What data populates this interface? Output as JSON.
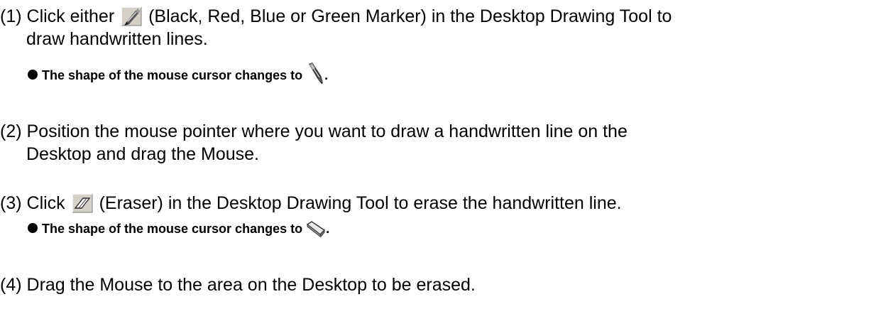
{
  "steps": [
    {
      "number": "(1)",
      "text_before_icon": "Click either",
      "icon": "marker-pen-icon",
      "text_after_icon_line1": "(Black, Red, Blue or Green Marker) in the Desktop Drawing Tool to",
      "text_line2": "draw handwritten lines.",
      "note": "The shape of the mouse cursor changes to",
      "note_icon": "marker-cursor-icon",
      "note_end": "."
    },
    {
      "number": "(2)",
      "text_line1": "Position the mouse pointer where you want to draw a handwritten line on the",
      "text_line2": "Desktop and drag the Mouse."
    },
    {
      "number": "(3)",
      "text_before_icon": "Click",
      "icon": "eraser-icon",
      "text_after_icon_line1": "(Eraser) in the Desktop Drawing Tool to erase the handwritten line.",
      "note": "The shape of the mouse cursor changes to",
      "note_icon": "eraser-cursor-icon",
      "note_end": "."
    },
    {
      "number": "(4)",
      "text_line1": "Drag the Mouse to the area on the Desktop to be erased."
    }
  ]
}
